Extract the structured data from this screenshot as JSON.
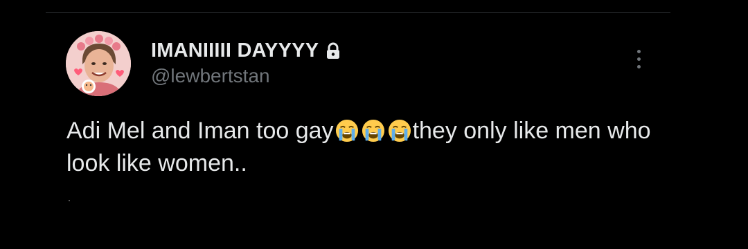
{
  "tweet": {
    "display_name": "IMANIIIII DAYYYY",
    "handle": "@lewbertstan",
    "text_parts": [
      "Adi Mel and Iman too gay",
      "they only like men who look like women.."
    ],
    "emoji_name": "loudly-crying-face",
    "emoji_count": 3,
    "protected_icon": "lock-icon",
    "more_icon": "more-vertical-icon"
  },
  "colors": {
    "background": "#000000",
    "primary_text": "#e7e9ea",
    "secondary_text": "#71767b",
    "divider": "#2f3336",
    "emoji_face": "#ffcc4d",
    "emoji_tears": "#5dadec"
  }
}
